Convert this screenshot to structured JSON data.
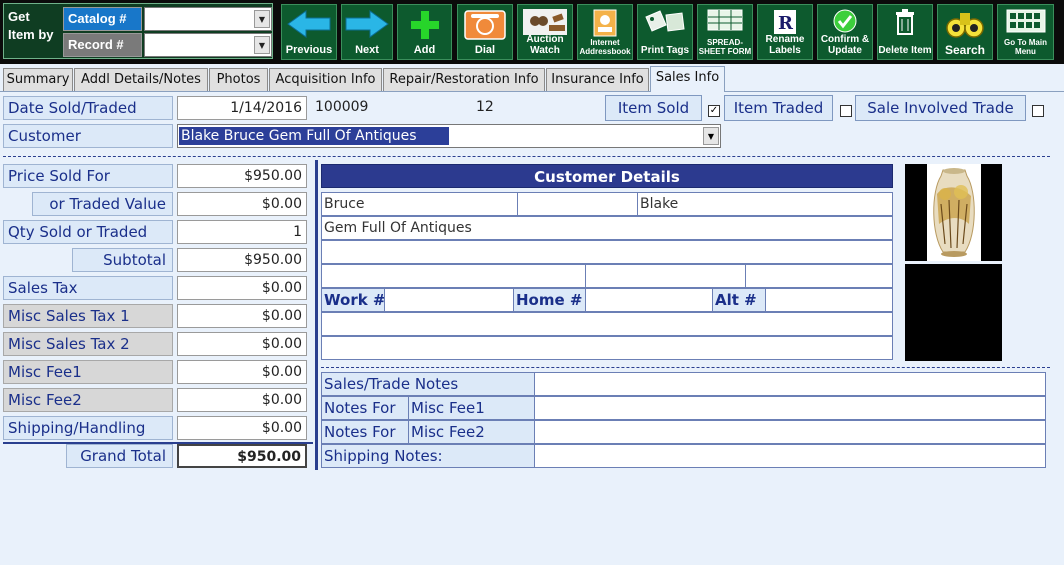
{
  "getby": {
    "label": "Get\nItem by",
    "catalog_btn": "Catalog #",
    "record_btn": "Record #",
    "catalog_value": "",
    "record_value": ""
  },
  "toolbar": {
    "previous": "Previous",
    "next": "Next",
    "add": "Add",
    "dial": "Dial",
    "auction_watch": "Auction Watch",
    "internet_addressbook": "Internet Addressbook",
    "print_tags": "Print Tags",
    "spreadsheet_form": "SPREAD- SHEET FORM",
    "rename_labels": "Rename Labels",
    "confirm_update": "Confirm & Update",
    "delete_item": "Delete Item",
    "search": "Search",
    "go_to_main_menu": "Go To Main Menu"
  },
  "tabs": [
    "Summary",
    "Addl Details/Notes",
    "Photos",
    "Acquisition Info",
    "Repair/Restoration Info",
    "Insurance Info",
    "Sales Info"
  ],
  "active_tab": "Sales Info",
  "sale": {
    "date_label": "Date Sold/Traded",
    "date_value": "1/14/2016",
    "ref_number": "100009",
    "ref_count": "12",
    "item_sold_label": "Item Sold",
    "item_sold_checked": "✓",
    "item_traded_label": "Item Traded",
    "sale_involved_trade_label": "Sale Involved Trade",
    "customer_label": "Customer",
    "customer_value": "Blake   Bruce   Gem Full Of Antiques"
  },
  "pricing": {
    "rows": [
      {
        "label": "Price Sold For",
        "value": "$950.00"
      },
      {
        "label": "or Traded Value",
        "value": "$0.00"
      },
      {
        "label": "Qty Sold or Traded",
        "value": "1"
      },
      {
        "label": "Subtotal",
        "value": "$950.00"
      },
      {
        "label": "Sales Tax",
        "value": "$0.00"
      },
      {
        "label": "Misc Sales Tax 1",
        "value": "$0.00"
      },
      {
        "label": "Misc Sales Tax 2",
        "value": "$0.00"
      },
      {
        "label": "Misc Fee1",
        "value": "$0.00"
      },
      {
        "label": "Misc Fee2",
        "value": "$0.00"
      },
      {
        "label": "Shipping/Handling",
        "value": "$0.00"
      }
    ],
    "grand_total_label": "Grand Total",
    "grand_total_value": "$950.00"
  },
  "customer_details": {
    "title": "Customer Details",
    "first_name": "Bruce",
    "middle": "",
    "last_name": "Blake",
    "company": "Gem Full Of Antiques",
    "work_label": "Work #",
    "home_label": "Home #",
    "alt_label": "Alt #"
  },
  "notes": {
    "sales_trade_notes": "Sales/Trade Notes",
    "notes_for": "Notes For",
    "misc_fee1": "Misc Fee1",
    "misc_fee2": "Misc Fee2",
    "shipping_notes": "Shipping Notes:"
  },
  "icons": {
    "previous": "arrow-left-icon",
    "next": "arrow-right-icon",
    "add": "plus-icon",
    "dial": "phone-icon",
    "auction": "gavel-icon",
    "addressbook": "addressbook-icon",
    "print": "tag-icon",
    "spreadsheet": "spreadsheet-icon",
    "rename": "rename-icon",
    "confirm": "checkmark-icon",
    "delete": "trash-icon",
    "search": "binoculars-icon",
    "menu": "grid-icon"
  },
  "colors": {
    "toolbar_bg": "#0d5a2e",
    "accent_blue": "#2c3a8f",
    "label_bg": "#dce9f8"
  }
}
